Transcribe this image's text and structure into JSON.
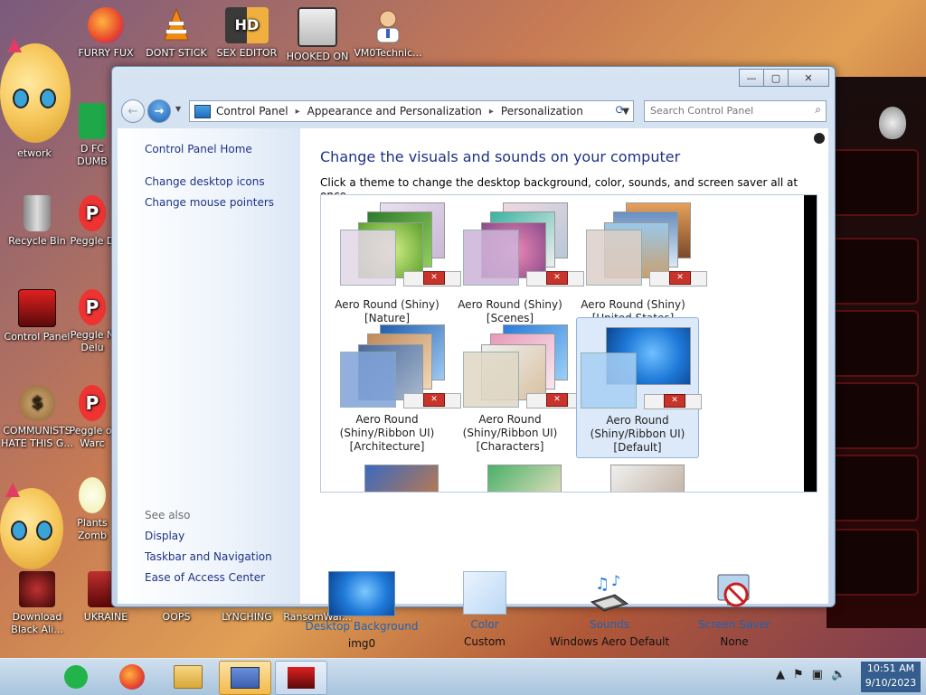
{
  "desktop": {
    "icons": [
      {
        "label": "FURRY FUX",
        "icon": "firefox-icon"
      },
      {
        "label": "DONT STICK",
        "icon": "vlc-cone-icon"
      },
      {
        "label": "SEX EDITOR",
        "icon": "editor-icon"
      },
      {
        "label": "HOOKED ON",
        "icon": "app-icon"
      },
      {
        "label": "VM0Technic...",
        "icon": "person-icon"
      },
      {
        "label": "Recycle Bin",
        "icon": "recycle-bin-icon"
      },
      {
        "label": "Control Panel",
        "icon": "control-panel-icon"
      },
      {
        "label": "COMMUNISTS HATE THIS G...",
        "icon": "money-bag-icon"
      },
      {
        "label": "Download Black Ali...",
        "icon": "download-icon"
      },
      {
        "label": "UKRAINE",
        "icon": "app-icon"
      },
      {
        "label": "OOPS",
        "icon": "app-icon"
      },
      {
        "label": "LYNCHING",
        "icon": "app-icon"
      },
      {
        "label": "RansomWar...",
        "icon": "app-icon"
      },
      {
        "label": "D FC DUMB",
        "icon": "app-icon"
      },
      {
        "label": "Peggle D",
        "icon": "peggle-icon"
      },
      {
        "label": "Peggle N Delu",
        "icon": "peggle-icon"
      },
      {
        "label": "Peggle of Warc",
        "icon": "peggle-icon"
      },
      {
        "label": "Plants Zomb",
        "icon": "flower-icon"
      },
      {
        "label": "etwork",
        "icon": "network-icon"
      },
      {
        "label": "N",
        "icon": "app-icon"
      }
    ]
  },
  "window": {
    "controls": {
      "minimize": "—",
      "maximize": "▢",
      "close": "✕"
    },
    "address": {
      "crumbs": [
        "Control Panel",
        "Appearance and Personalization",
        "Personalization"
      ],
      "separator": "▸"
    },
    "search": {
      "placeholder": "Search Control Panel"
    },
    "left": {
      "home": "Control Panel Home",
      "links": [
        "Change desktop icons",
        "Change mouse pointers"
      ],
      "see_also_label": "See also",
      "see_also": [
        "Display",
        "Taskbar and Navigation",
        "Ease of Access Center"
      ]
    },
    "main": {
      "title": "Change the visuals and sounds on your computer",
      "subtitle": "Click a theme to change the desktop background, color, sounds, and screen saver all at once.",
      "themes": [
        {
          "line1": "Aero Round (Shiny)",
          "line2": "[Nature]",
          "line3": "",
          "colors": [
            "#9fd26a",
            "#4a8a2a",
            "#d8c9d9"
          ],
          "selected": false
        },
        {
          "line1": "Aero Round (Shiny)",
          "line2": "[Scenes]",
          "line3": "",
          "colors": [
            "#d96b98",
            "#3ab3a0",
            "#cbb3d9"
          ],
          "selected": false
        },
        {
          "line1": "Aero Round (Shiny)",
          "line2": "[United States]",
          "line3": "",
          "colors": [
            "#d9a36a",
            "#6a8fc0",
            "#d9cdc6"
          ],
          "selected": false
        },
        {
          "line1": "Aero Round",
          "line2": "(Shiny/Ribbon UI)",
          "line3": "[Architecture]",
          "colors": [
            "#3a78c0",
            "#c08a5a",
            "#7fa2d9"
          ],
          "selected": false
        },
        {
          "line1": "Aero Round",
          "line2": "(Shiny/Ribbon UI)",
          "line3": "[Characters]",
          "colors": [
            "#e89ab8",
            "#4aa0d8",
            "#d9d2c2"
          ],
          "selected": false
        },
        {
          "line1": "Aero Round",
          "line2": "(Shiny/Ribbon UI)",
          "line3": "[Default]",
          "colors": [
            "#1f7ad9",
            "#0a4fa8",
            "#a8d0f5"
          ],
          "selected": true
        }
      ]
    },
    "bottom": [
      {
        "title": "Desktop Background",
        "value": "img0",
        "icon": "desktop-background-icon"
      },
      {
        "title": "Color",
        "value": "Custom",
        "icon": "color-swatch-icon"
      },
      {
        "title": "Sounds",
        "value": "Windows Aero Default",
        "icon": "sounds-icon"
      },
      {
        "title": "Screen Saver",
        "value": "None",
        "icon": "screen-saver-icon"
      }
    ]
  },
  "taskbar": {
    "clock_time": "10:51 AM",
    "clock_date": "9/10/2023"
  },
  "colors": {
    "link": "#1e3287",
    "accent_blue": "#1f63b4",
    "taskbar": "#b9d0e6"
  }
}
